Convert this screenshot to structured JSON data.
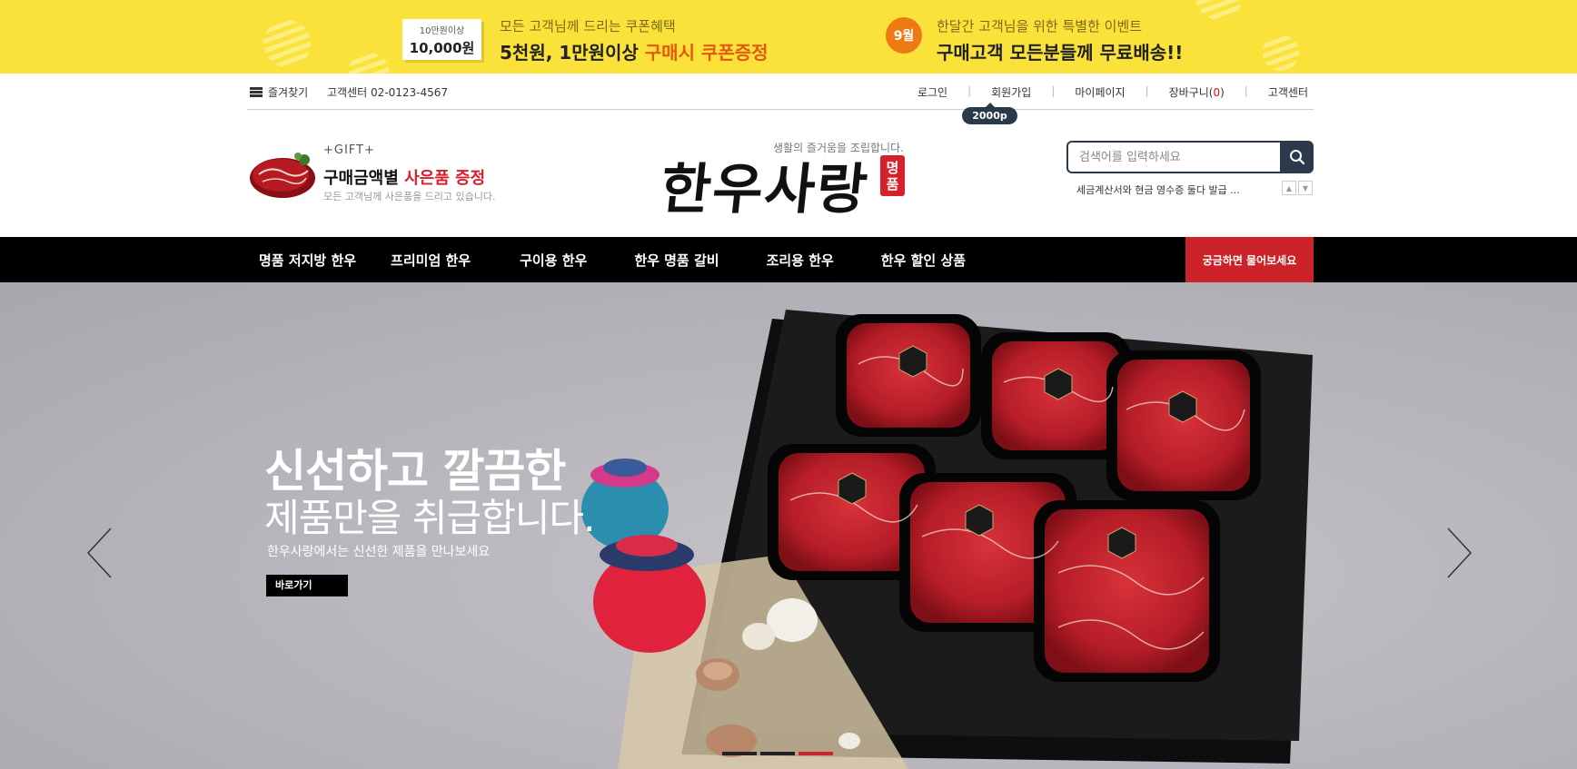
{
  "top_banner": {
    "coupon_small": "10만원이상",
    "coupon_big": "10,000원",
    "promo1_line1": "모든 고객님께 드리는 쿠폰혜택",
    "promo1_line2_prefix": "5천원, 1만원이상 ",
    "promo1_line2_em": "구매시 쿠폰증정",
    "month_badge": "9월",
    "promo2_line1": "한달간 고객님을 위한 특별한 이벤트",
    "promo2_line2": "구매고객 모든분들께 무료배송!!",
    "colors": {
      "background": "#fbe23a",
      "accent": "#e15a0f",
      "badge": "#ef7a14"
    }
  },
  "utility": {
    "favorites": "즐겨찾기",
    "customer_center_phone": "고객센터 02-0123-4567",
    "links": {
      "login": "로그인",
      "join": "회원가입",
      "mypage": "마이페이지",
      "cart_prefix": "장바구니(",
      "cart_count": "0",
      "cart_suffix": ")",
      "customer_center": "고객센터"
    },
    "separator": "|",
    "join_points": "2000p"
  },
  "header": {
    "gift_tag": "+GIFT+",
    "gift_title_prefix": "구매금액별 ",
    "gift_title_red": "사은품 증정",
    "gift_sub": "모든 고객님께 사은품을 드리고 있습니다.",
    "logo_tagline": "생활의 즐거움을 조립합니다.",
    "logo_text": "한우사랑",
    "logo_seal_1": "명",
    "logo_seal_2": "품",
    "search_placeholder": "검색어를 입력하세요",
    "rolling_notice": "세금계산서와 현금 영수증 둘다 발급 ..."
  },
  "nav": {
    "items": [
      "명품 저지방 한우",
      "프리미엄 한우",
      "구이용 한우",
      "한우 명품 갈비",
      "조리용 한우",
      "한우 할인 상품"
    ],
    "ask_button": "궁금하면 물어보세요",
    "colors": {
      "background": "#000000",
      "ask": "#cc2229"
    }
  },
  "hero": {
    "title_line1": "신선하고 깔끔한",
    "title_line2": "제품만을 취급합니다.",
    "subtitle": "한우사랑에서는 신선한 제품을 만나보세요",
    "button": "바로가기",
    "slide_count": 3,
    "active_slide": 3
  }
}
